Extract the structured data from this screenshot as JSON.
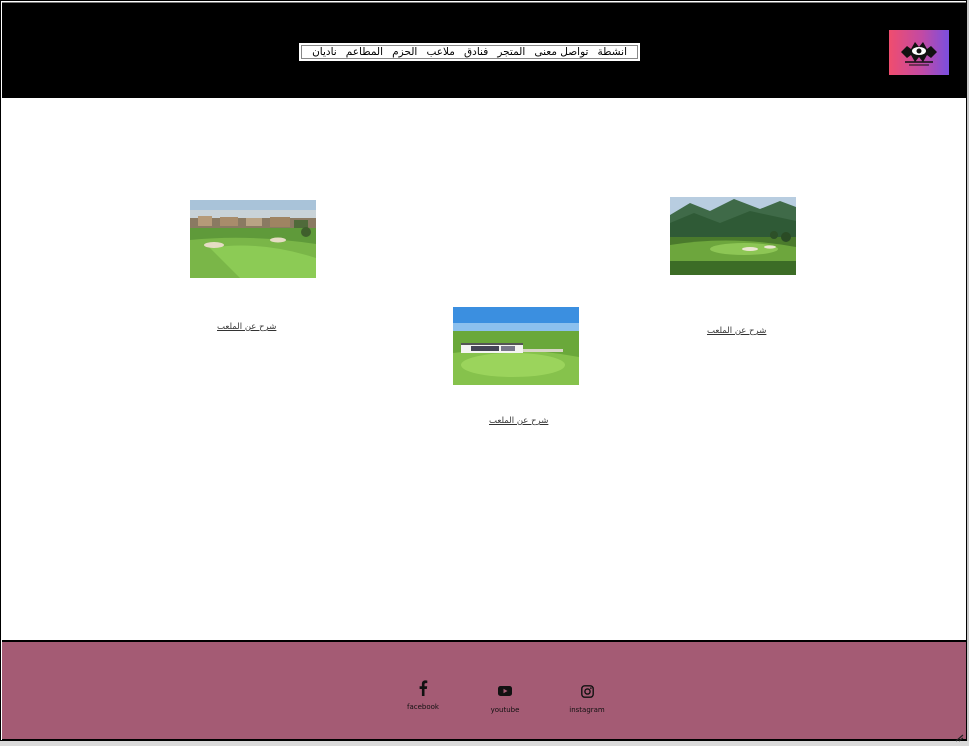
{
  "nav": {
    "items": [
      {
        "label": "ناديان"
      },
      {
        "label": "المطاعم"
      },
      {
        "label": "الحزم"
      },
      {
        "label": "ملاعب"
      },
      {
        "label": "فنادق"
      },
      {
        "label": "المتجر"
      },
      {
        "label": "تواصل معنى"
      },
      {
        "label": "انشطة"
      }
    ]
  },
  "courses": [
    {
      "link": "شرح عن الملعب",
      "image": "golf-course-with-hotel"
    },
    {
      "link": "شرح عن الملعب",
      "image": "golf-course-clubhouse"
    },
    {
      "link": "شرح عن الملعب",
      "image": "golf-course-mountains"
    }
  ],
  "footer": {
    "facebook": "facebook",
    "youtube": "youtube",
    "instagram": "instagram"
  },
  "colors": {
    "header_bg": "#000000",
    "footer_bg": "#a45b74",
    "logo_gradient": [
      "#f04d6e",
      "#7a4fe0"
    ]
  }
}
